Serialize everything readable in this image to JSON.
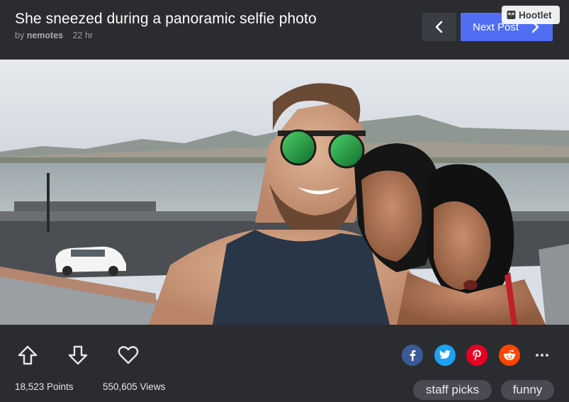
{
  "post": {
    "title": "She sneezed during a panoramic selfie photo",
    "by_prefix": "by",
    "author": "nemotes",
    "age": "22 hr"
  },
  "nav": {
    "prev_icon": "chevron-left-icon",
    "next_label": "Next Post",
    "next_icon": "chevron-right-icon"
  },
  "hootlet": {
    "label": "Hootlet",
    "icon": "owl-icon"
  },
  "image": {
    "subject": "panoramic selfie photo"
  },
  "actions": {
    "upvote_icon": "arrow-up-icon",
    "downvote_icon": "arrow-down-icon",
    "like_icon": "heart-icon"
  },
  "stats": {
    "points": "18,523 Points",
    "views": "550,605 Views"
  },
  "share": [
    {
      "network": "facebook",
      "glyph": "f",
      "color": "#3b5998"
    },
    {
      "network": "twitter",
      "glyph": "t",
      "color": "#1da1f2"
    },
    {
      "network": "pinterest",
      "glyph": "p",
      "color": "#e60023"
    },
    {
      "network": "reddit",
      "glyph": "r",
      "color": "#ff4500"
    }
  ],
  "more_icon": "more-dots-icon",
  "tags": [
    "staff picks",
    "funny"
  ],
  "colors": {
    "background": "#2b2c30",
    "accent": "#4f6ef3",
    "prev_button": "#3b3d45",
    "tag_bg": "#4a4b52"
  }
}
